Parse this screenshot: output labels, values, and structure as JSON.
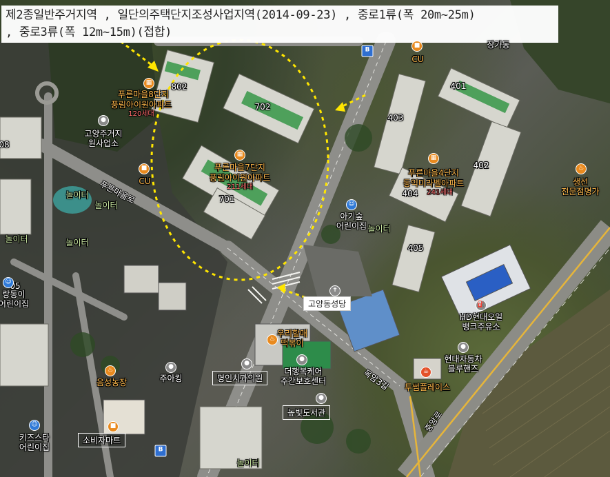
{
  "info_box": {
    "line1": "제2종일반주거지역 , 일단의주택단지조성사업지역(2014-09-23) , 중로1류(폭 20m~25m)",
    "line2": ", 중로3류(폭 12m~15m)(접합)"
  },
  "complexes": [
    {
      "name": "푸른마을8단지",
      "sub": "풍림아이원아파트",
      "units": "120세대"
    },
    {
      "name": "푸른마을7단지",
      "sub": "풍림아이원아파트",
      "units": "211세대"
    },
    {
      "name": "푸른마을4단지",
      "sub": "동익미라벨아파트",
      "units": "241세대"
    }
  ],
  "building_numbers": [
    "802",
    "702",
    "701",
    "401",
    "403",
    "402",
    "404",
    "405",
    "08",
    "05"
  ],
  "places": {
    "cu1": "CU",
    "cu2": "CU",
    "office": "고양주거지\n원사업소",
    "kid1": "아기숲\n어린이집",
    "kid2": "랑동이\n어린이집",
    "kid3": "키즈스타\n어린이집",
    "church": "고양동성당",
    "fish": "생선\n전문점명가",
    "gas": "HD현대오일\n뱅크주유소",
    "car": "현대자동차\n블루핸즈",
    "tteok": "우리할매\n떡볶이",
    "dental": "명인치과의원",
    "care": "더행복케어\n주간보호센터",
    "library": "높빛도서관",
    "mart": "소비자마트",
    "parking": "주아킹",
    "chicken": "음성농장",
    "topplace": "투썸플레이스",
    "top_right": "장가동"
  },
  "playgrounds": [
    "놀이터",
    "놀이터",
    "놀이터",
    "놀이터",
    "놀이터",
    "놀이터"
  ],
  "roads": {
    "road1": "푸른마을로",
    "road2": "목암3길",
    "road3": "중앙로"
  },
  "icons": {
    "apartment": "building-icon",
    "convenience": "store-icon",
    "daycare": "daycare-icon",
    "church": "church-icon",
    "bus": "bus-stop-icon"
  },
  "colors": {
    "highlight": "#ffe600",
    "accent": "#e98a1e"
  }
}
